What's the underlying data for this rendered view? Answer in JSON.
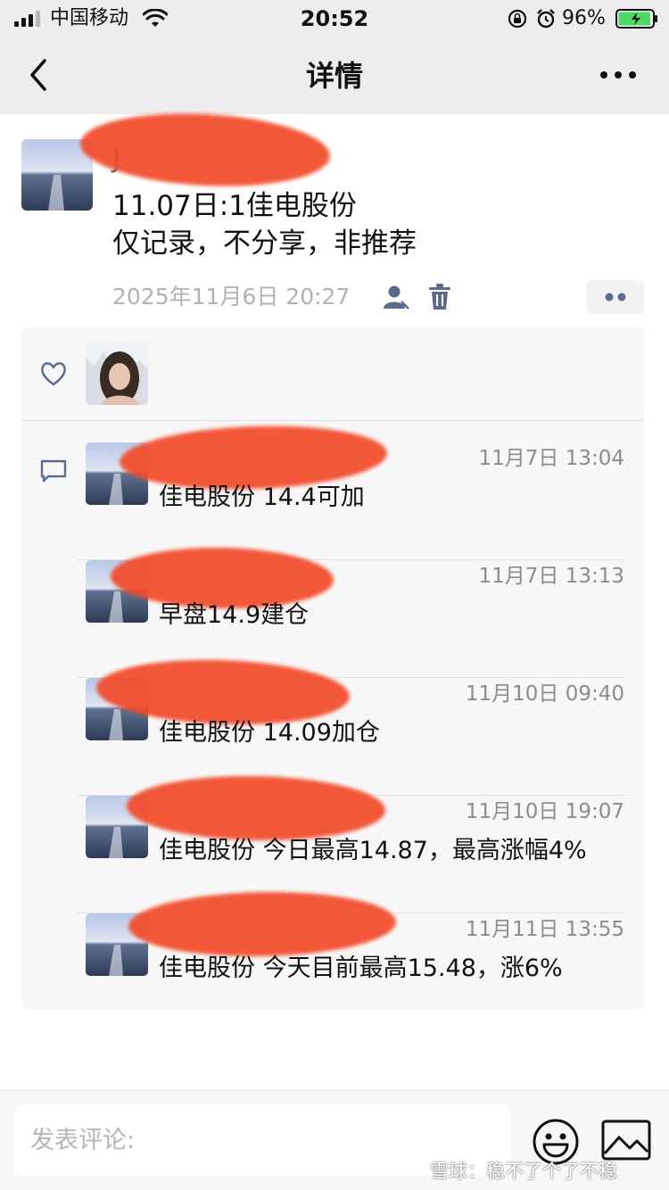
{
  "status_bar": {
    "carrier": "中国移动",
    "time": "20:52",
    "battery_percent": "96%",
    "battery_level": 0.96
  },
  "nav": {
    "title": "详情",
    "back_icon": "chevron-left-icon",
    "more_icon": "ellipsis-icon"
  },
  "post": {
    "author": "J",
    "content_line1": "11.07日:1佳电股份",
    "content_line2": "仅记录，不分享，非推荐",
    "timestamp": "2025年11月6日 20:27",
    "author_name_redacted": true
  },
  "interactions": {
    "like_icon": "heart-icon",
    "comment_icon": "comment-icon",
    "comments": [
      {
        "time": "11月7日 13:04",
        "text": "佳电股份 14.4可加"
      },
      {
        "time": "11月7日 13:13",
        "text": "早盘14.9建仓"
      },
      {
        "time": "11月10日 09:40",
        "text": "佳电股份 14.09加仓"
      },
      {
        "time": "11月10日 19:07",
        "text": "佳电股份 今日最高14.87，最高涨幅4%"
      },
      {
        "time": "11月11日 13:55",
        "text": "佳电股份 今天目前最高15.48，涨6%"
      }
    ]
  },
  "bottom_bar": {
    "comment_placeholder": "发表评论:",
    "watermark": "雪球：稳不了个了不稳"
  },
  "colors": {
    "bar_bg": "#ededed",
    "panel_bg": "#f7f7f7",
    "name_blue": "#5a6b8c",
    "redaction_red": "#f24b2a",
    "battery_green": "#4cd964"
  }
}
